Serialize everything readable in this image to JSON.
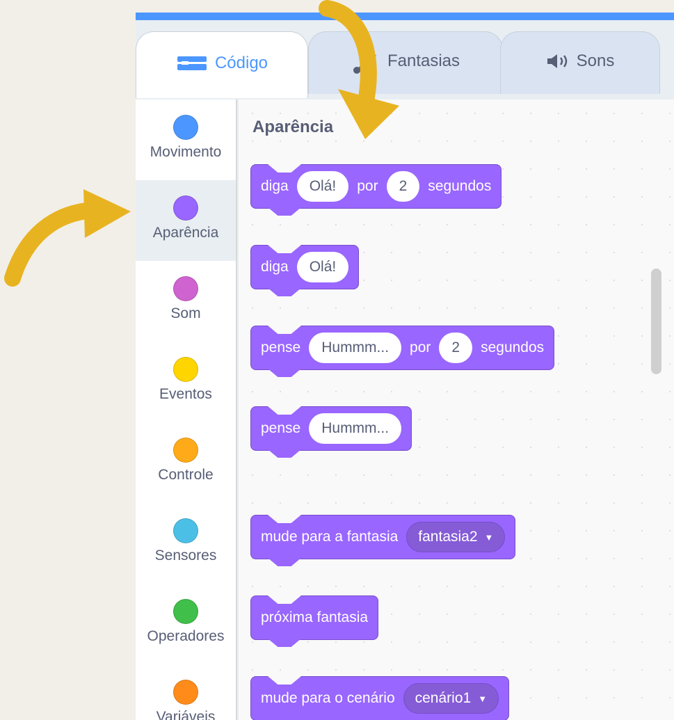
{
  "tabs": [
    {
      "label": "Código",
      "icon": "code-icon",
      "active": true
    },
    {
      "label": "Fantasias",
      "icon": "brush-icon",
      "active": false
    },
    {
      "label": "Sons",
      "icon": "speaker-icon",
      "active": false
    }
  ],
  "categories": [
    {
      "label": "Movimento",
      "color": "#4c97ff"
    },
    {
      "label": "Aparência",
      "color": "#9966ff",
      "selected": true
    },
    {
      "label": "Som",
      "color": "#cf63cf"
    },
    {
      "label": "Eventos",
      "color": "#ffd500"
    },
    {
      "label": "Controle",
      "color": "#ffab19"
    },
    {
      "label": "Sensores",
      "color": "#4cbfe6"
    },
    {
      "label": "Operadores",
      "color": "#40bf4a"
    },
    {
      "label": "Variáveis",
      "color": "#ff8c1a"
    }
  ],
  "workspace": {
    "section_title": "Aparência",
    "blocks": [
      {
        "parts": [
          "diga",
          "Olá!",
          "por",
          "2",
          "segundos"
        ]
      },
      {
        "parts": [
          "diga",
          "Olá!"
        ]
      },
      {
        "parts": [
          "pense",
          "Hummm...",
          "por",
          "2",
          "segundos"
        ]
      },
      {
        "parts": [
          "pense",
          "Hummm..."
        ]
      },
      {
        "parts": [
          "mude para a fantasia",
          "fantasia2"
        ]
      },
      {
        "parts": [
          "próxima fantasia"
        ]
      },
      {
        "parts": [
          "mude para o cenário",
          "cenário1"
        ]
      }
    ]
  },
  "colors": {
    "looks_block": "#9966ff",
    "accent": "#4c97ff",
    "annotation_arrow": "#e8b321"
  }
}
